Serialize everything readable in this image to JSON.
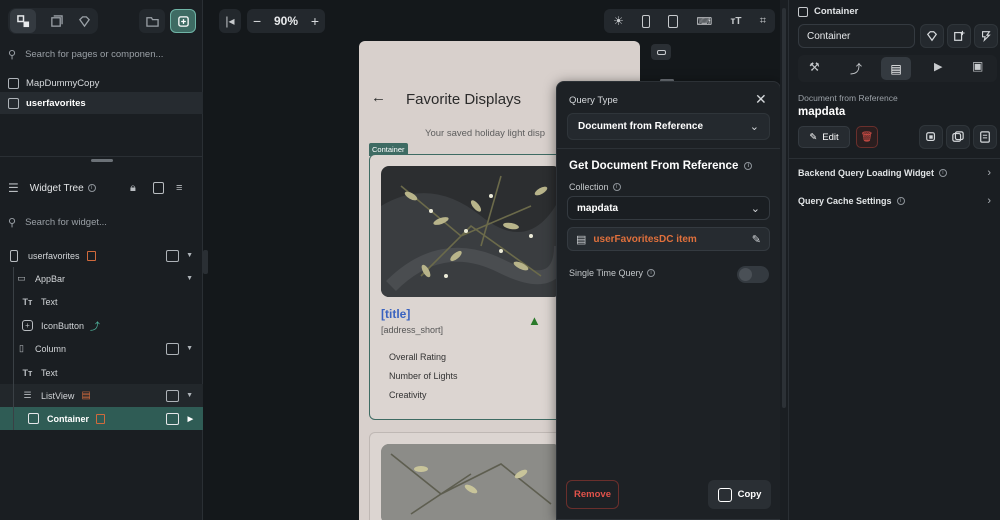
{
  "left": {
    "search_placeholder": "Search for pages or componen...",
    "pages": [
      {
        "label": "MapDummyCopy",
        "active": false
      },
      {
        "label": "userfavorites",
        "active": true
      }
    ],
    "widget_tree_title": "Widget Tree",
    "widget_search_placeholder": "Search for widget...",
    "tree": [
      {
        "label": "userfavorites",
        "glyph": "phone"
      },
      {
        "label": "AppBar",
        "glyph": "appbar"
      },
      {
        "label": "Text",
        "glyph": "Tт"
      },
      {
        "label": "IconButton",
        "glyph": "plus"
      },
      {
        "label": "Column",
        "glyph": "column"
      },
      {
        "label": "Text",
        "glyph": "Tт"
      },
      {
        "label": "ListView",
        "glyph": "list"
      },
      {
        "label": "Container",
        "glyph": "box"
      }
    ]
  },
  "toolbar": {
    "zoom": "90%",
    "zoom_out": "−",
    "zoom_in": "+"
  },
  "phone": {
    "title": "Favorite Displays",
    "subtitle": "Your saved holiday light disp",
    "container_tag": "Container",
    "card_title": "[title]",
    "card_address": "[address_short]",
    "ratings": [
      "Overall Rating",
      "Number of Lights",
      "Creativity"
    ]
  },
  "query": {
    "type_label": "Query Type",
    "type_value": "Document from Reference",
    "heading": "Get Document From Reference",
    "collection_label": "Collection",
    "collection_value": "mapdata",
    "reference_value": "userFavoritesDC item",
    "single_time_label": "Single Time Query",
    "remove_label": "Remove",
    "copy_label": "Copy"
  },
  "right": {
    "checkbox_label": "Container",
    "name_input": "Container",
    "doc_ref_label": "Document from Reference",
    "doc_ref_value": "mapdata",
    "edit_label": "Edit",
    "backend_loading": "Backend Query Loading Widget",
    "cache_settings": "Query Cache Settings"
  },
  "colors": {
    "accent_teal": "#3e6b63",
    "accent_orange": "#e0703c",
    "danger": "#e0524a",
    "link_blue": "#3a63c0"
  }
}
